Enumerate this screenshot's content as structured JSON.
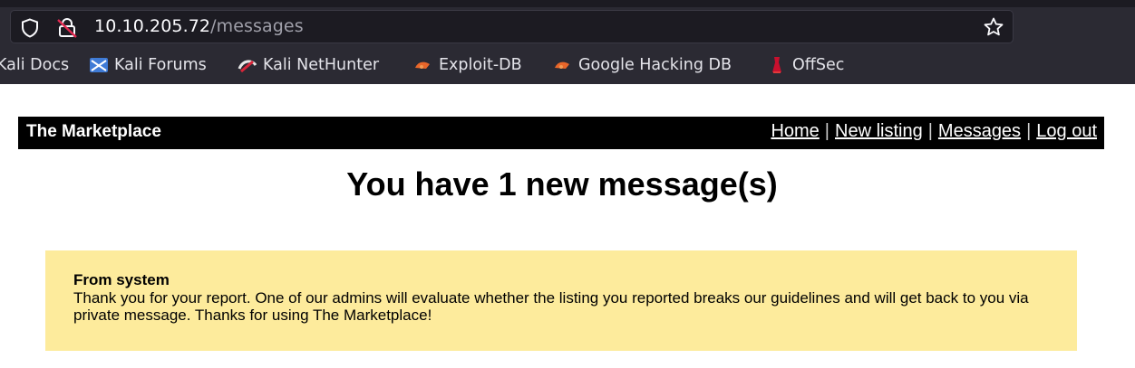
{
  "browser": {
    "url_host": "10.10.205.72",
    "url_path": "/messages",
    "bookmarks": [
      {
        "label": "Kali Docs",
        "icon": "kali-docs-icon"
      },
      {
        "label": "Kali Forums",
        "icon": "kali-forums-icon"
      },
      {
        "label": "Kali NetHunter",
        "icon": "kali-nethunter-icon"
      },
      {
        "label": "Exploit-DB",
        "icon": "exploit-db-icon"
      },
      {
        "label": "Google Hacking DB",
        "icon": "ghdb-icon"
      },
      {
        "label": "OffSec",
        "icon": "offsec-icon"
      }
    ]
  },
  "navbar": {
    "brand": "The Marketplace",
    "links": [
      "Home",
      "New listing",
      "Messages",
      "Log out"
    ],
    "separator": "|"
  },
  "page": {
    "heading": "You have 1 new message(s)"
  },
  "message": {
    "from": "From system",
    "body": "Thank you for your report. One of our admins will evaluate whether the listing you reported breaks our guidelines and will get back to you via private message. Thanks for using The Marketplace!"
  },
  "colors": {
    "chrome": "#2b2a33",
    "urlbar": "#1c1b22",
    "navbar": "#000000",
    "message_bg": "#fdeb9c"
  }
}
